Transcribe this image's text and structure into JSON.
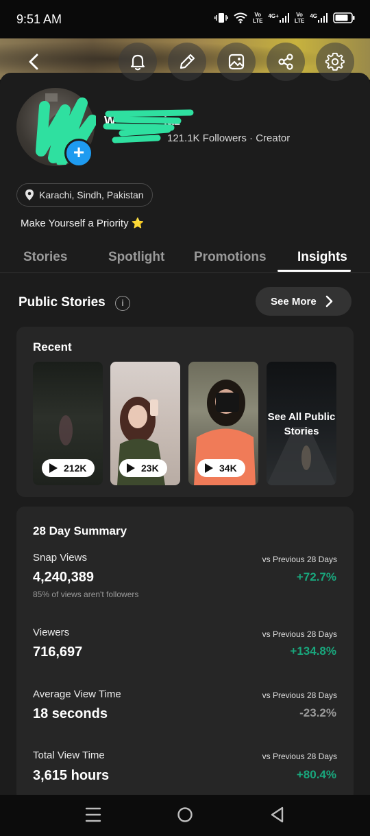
{
  "status_bar": {
    "time": "9:51 AM",
    "net1_top": "Vo",
    "net1_bottom": "LTE",
    "net2_top": "4G+",
    "net3_top": "Vo",
    "net3_bottom": "LTE",
    "net4_top": "4G"
  },
  "profile": {
    "name": "W",
    "name_tail": "iaz",
    "followers_meta": "121.1K Followers · Creator",
    "location": "Karachi, Sindh, Pakistan",
    "bio": "Make Yourself a Priority ⭐"
  },
  "tabs": [
    {
      "label": "Stories"
    },
    {
      "label": "Spotlight"
    },
    {
      "label": "Promotions"
    },
    {
      "label": "Insights"
    }
  ],
  "public_stories": {
    "title": "Public Stories",
    "info": "i",
    "see_more": "See More",
    "recent_label": "Recent",
    "thumbs": [
      {
        "views": "212K"
      },
      {
        "views": "23K"
      },
      {
        "views": "34K"
      }
    ],
    "see_all_line1": "See All Public",
    "see_all_line2": "Stories"
  },
  "summary": {
    "title": "28 Day Summary",
    "metrics": [
      {
        "label": "Snap Views",
        "value": "4,240,389",
        "note": "85% of views aren't followers",
        "vs": "vs Previous 28 Days",
        "delta": "+72.7%"
      },
      {
        "label": "Viewers",
        "value": "716,697",
        "vs": "vs Previous 28 Days",
        "delta": "+134.8%"
      },
      {
        "label": "Average View Time",
        "value": "18 seconds",
        "vs": "vs Previous 28 Days",
        "delta": "-23.2%"
      },
      {
        "label": "Total View Time",
        "value": "3,615 hours",
        "vs": "vs Previous 28 Days",
        "delta": "+80.4%"
      }
    ]
  },
  "colors": {
    "accent_blue": "#1e9bf0",
    "positive": "#19a77d",
    "negative": "#9a9a9a",
    "scribble": "#2fe0a0"
  }
}
